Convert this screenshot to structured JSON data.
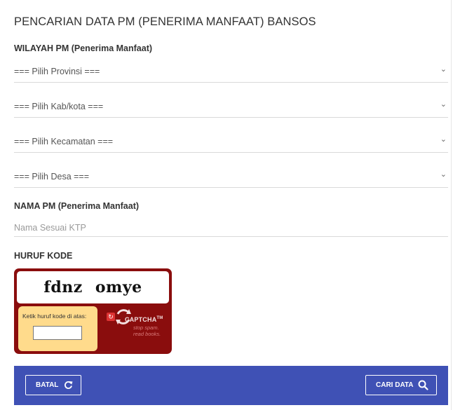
{
  "page": {
    "title": "PENCARIAN DATA PM (PENERIMA MANFAAT) BANSOS"
  },
  "wilayah": {
    "label": "WILAYAH PM (Penerima Manfaat)",
    "provinsi": "=== Pilih Provinsi ===",
    "kabkota": "=== Pilih Kab/kota ===",
    "kecamatan": "=== Pilih Kecamatan ===",
    "desa": "=== Pilih Desa ==="
  },
  "nama": {
    "label": "NAMA PM (Penerima Manfaat)",
    "placeholder": "Nama Sesuai KTP"
  },
  "captcha": {
    "label": "HURUF KODE",
    "text": "fdnz omye",
    "entry_label": "Ketik huruf kode di atas:",
    "brand_name": "CAPTCHA",
    "brand_tm": "TM",
    "tagline1": "stop spam.",
    "tagline2": "read books."
  },
  "actions": {
    "batal_label": "BATAL",
    "cari_label": "CARI DATA"
  },
  "colors": {
    "footer": "#3f51b5",
    "captcha_bg": "#8a0d0d",
    "captcha_entry": "#ffdb8c"
  },
  "icons": {
    "chevron": "chevron-down-icon",
    "refresh": "refresh-icon",
    "search": "search-icon"
  }
}
